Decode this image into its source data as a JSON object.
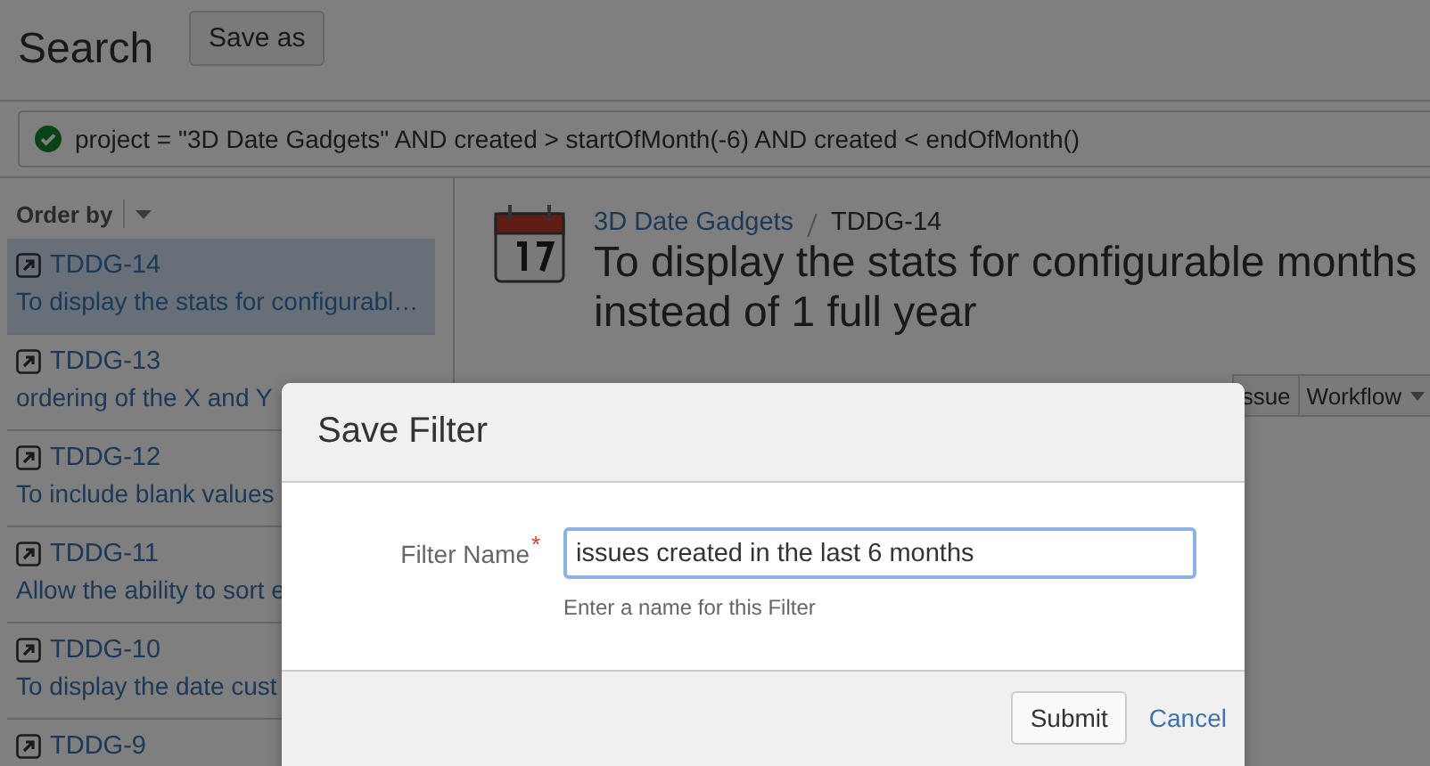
{
  "header": {
    "title": "Search",
    "save_as_button": "Save as"
  },
  "query": {
    "valid": true,
    "text": "project = \"3D Date Gadgets\" AND created > startOfMonth(-6) AND created < endOfMonth()"
  },
  "order_by": {
    "label": "Order by"
  },
  "issues": [
    {
      "key": "TDDG-14",
      "summary": "To display the stats for configurabl…",
      "selected": true
    },
    {
      "key": "TDDG-13",
      "summary": "ordering of the X and Y",
      "selected": false
    },
    {
      "key": "TDDG-12",
      "summary": "To include blank values",
      "selected": false
    },
    {
      "key": "TDDG-11",
      "summary": "Allow the ability to sort e",
      "selected": false
    },
    {
      "key": "TDDG-10",
      "summary": "To display the date cust",
      "selected": false
    },
    {
      "key": "TDDG-9",
      "selected": false
    }
  ],
  "issue_detail": {
    "project": "3D Date Gadgets",
    "key": "TDDG-14",
    "title": "To display the stats for configurable months instead of 1 full year",
    "toolbar": [
      {
        "label": "ssue",
        "menu": false
      },
      {
        "label": "Workflow",
        "menu": true
      }
    ]
  },
  "dialog": {
    "title": "Save Filter",
    "field_label": "Filter Name",
    "required": true,
    "required_mark": "*",
    "value": "issues created in the last 6 months",
    "hint": "Enter a name for this Filter",
    "submit": "Submit",
    "cancel": "Cancel"
  }
}
